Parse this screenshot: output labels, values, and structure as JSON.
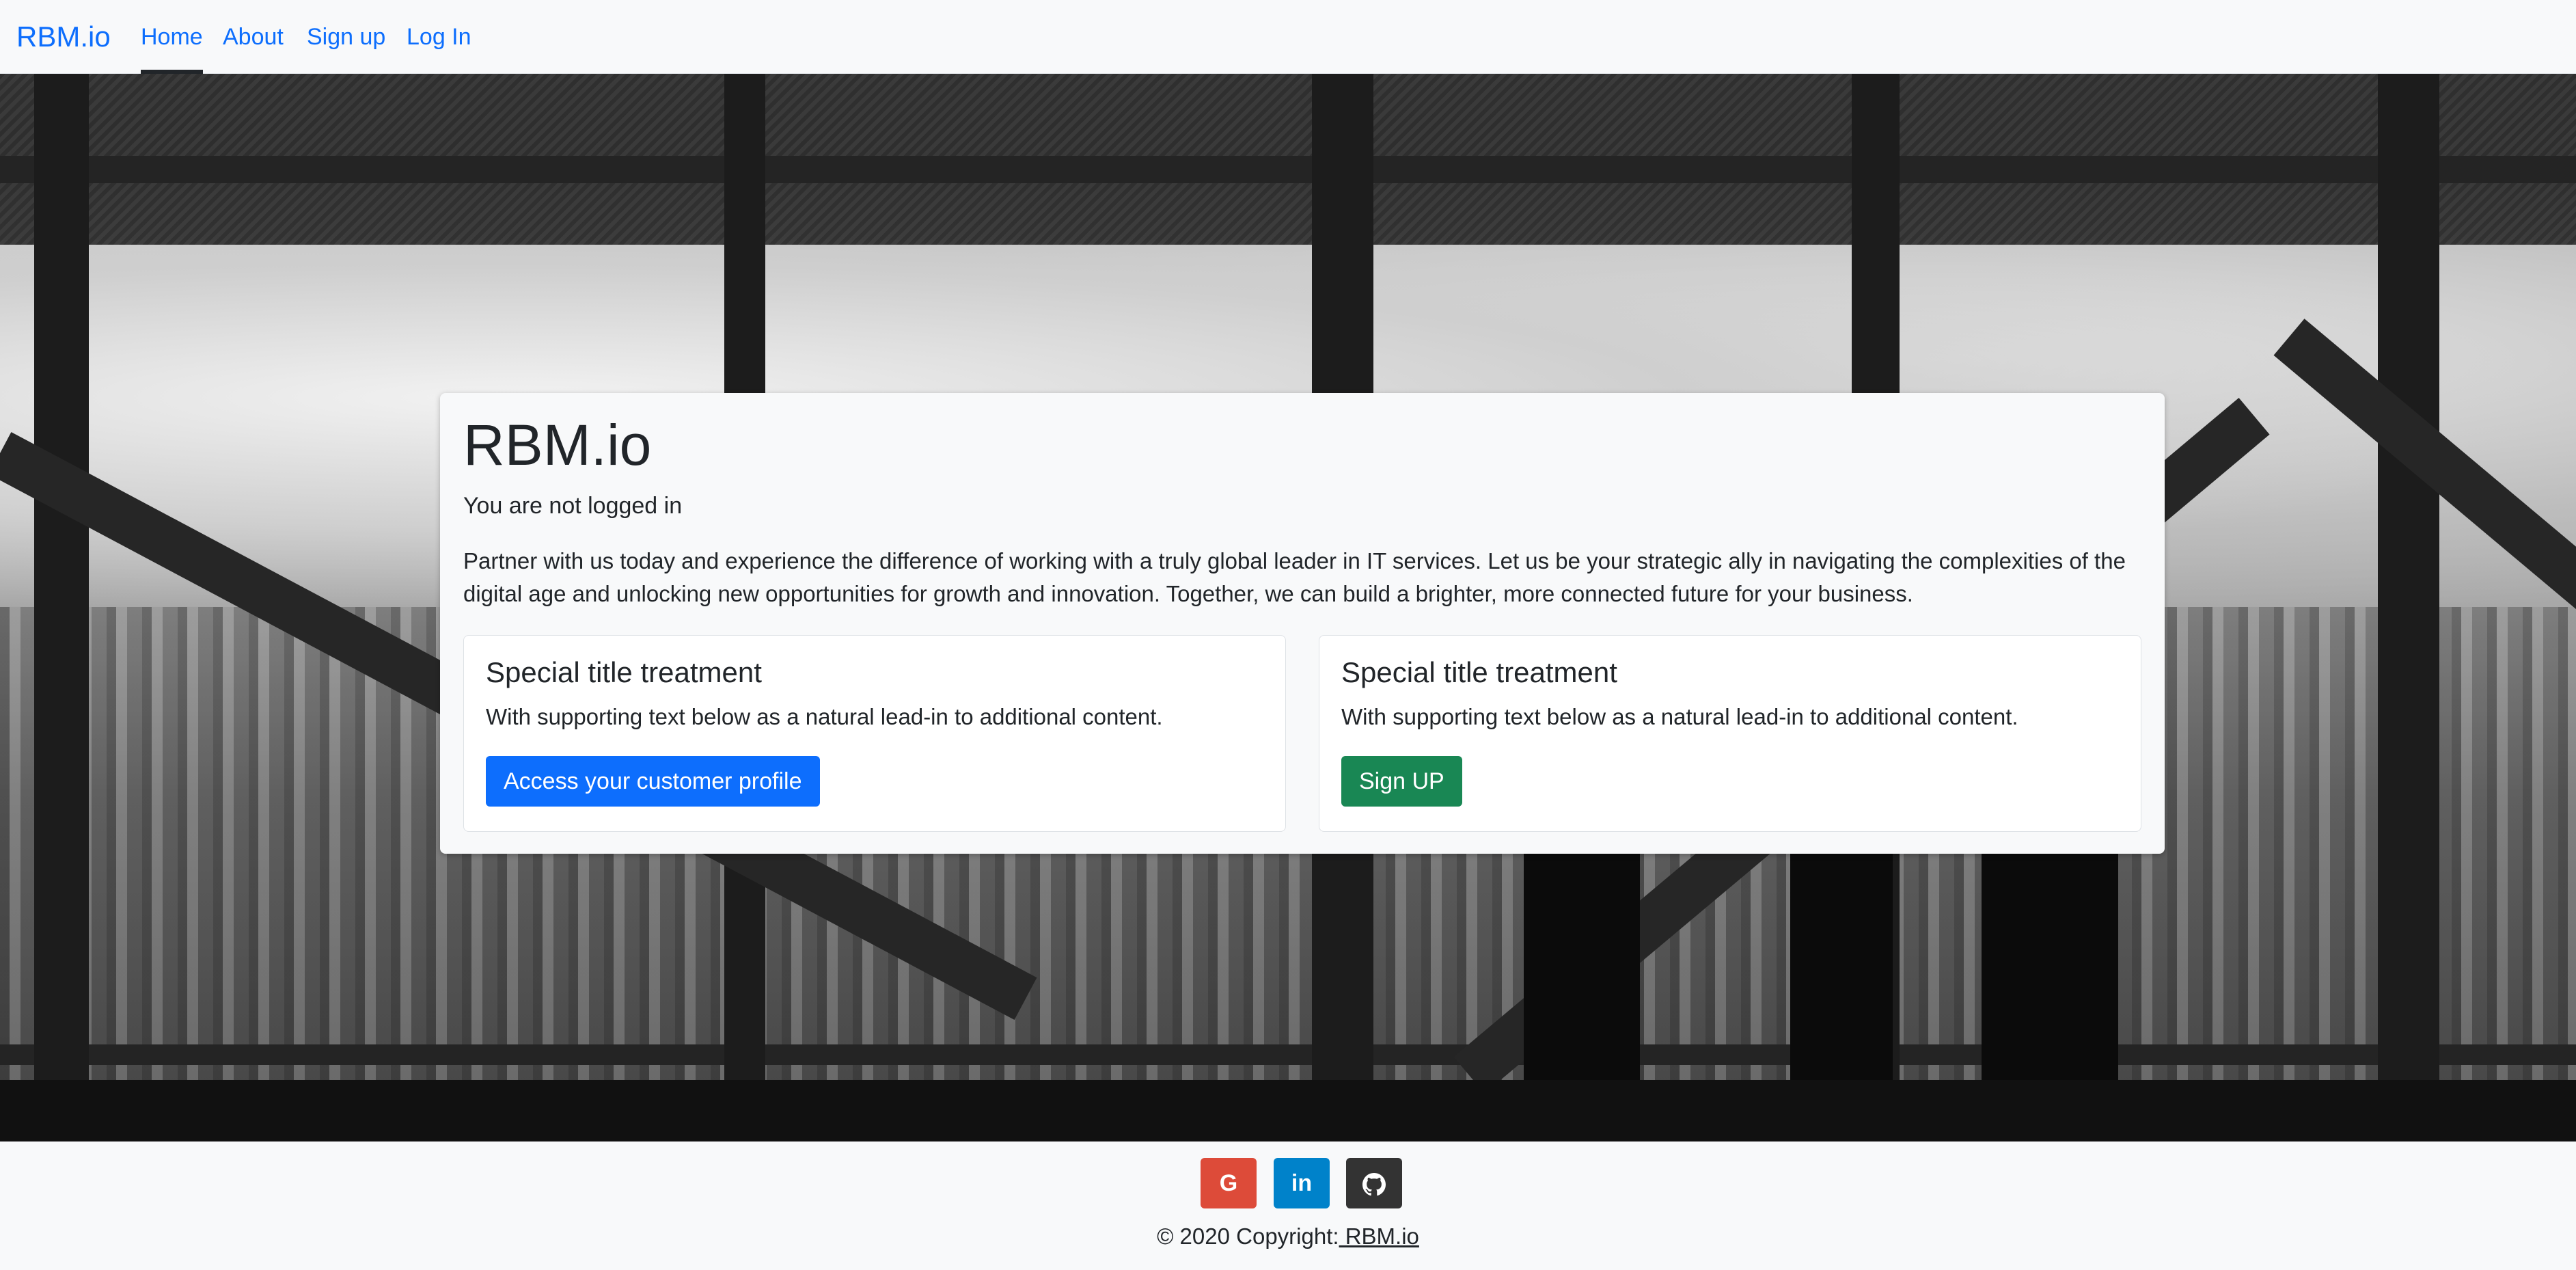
{
  "navbar": {
    "brand": "RBM.io",
    "links": [
      {
        "label": "Home",
        "active": true
      },
      {
        "label": "About"
      },
      {
        "label": "Sign up"
      },
      {
        "label": "Log In"
      }
    ]
  },
  "jumbotron": {
    "title": "RBM.io",
    "status": "You are not logged in",
    "lead": "Partner with us today and experience the difference of working with a truly global leader in IT services. Let us be your strategic ally in navigating the complexities of the digital age and unlocking new opportunities for growth and innovation. Together, we can build a brighter, more connected future for your business."
  },
  "cards": [
    {
      "title": "Special title treatment",
      "text": "With supporting text below as a natural lead-in to additional content.",
      "button": "Access your customer profile"
    },
    {
      "title": "Special title treatment",
      "text": "With supporting text below as a natural lead-in to additional content.",
      "button": "Sign UP"
    }
  ],
  "footer": {
    "social": [
      {
        "icon": "google-icon",
        "glyph": "G",
        "color": "#dd4b39"
      },
      {
        "icon": "linkedin-icon",
        "glyph": "in",
        "color": "#0082ca"
      },
      {
        "icon": "github-icon",
        "glyph": "",
        "color": "#333333"
      }
    ],
    "copyright_prefix": "© 2020 Copyright:",
    "copyright_link": " RBM.io"
  },
  "colors": {
    "primary": "#0d6efd",
    "success": "#198754"
  }
}
